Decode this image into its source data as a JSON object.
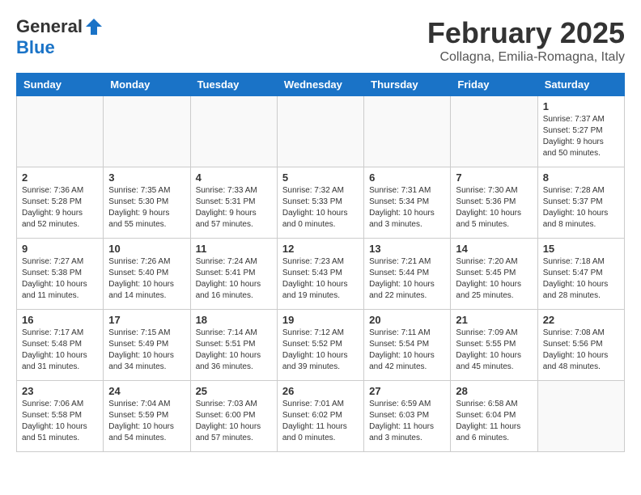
{
  "header": {
    "logo": {
      "general": "General",
      "blue": "Blue"
    },
    "title": "February 2025",
    "subtitle": "Collagna, Emilia-Romagna, Italy"
  },
  "weekdays": [
    "Sunday",
    "Monday",
    "Tuesday",
    "Wednesday",
    "Thursday",
    "Friday",
    "Saturday"
  ],
  "weeks": [
    {
      "days": [
        {
          "num": "",
          "info": ""
        },
        {
          "num": "",
          "info": ""
        },
        {
          "num": "",
          "info": ""
        },
        {
          "num": "",
          "info": ""
        },
        {
          "num": "",
          "info": ""
        },
        {
          "num": "",
          "info": ""
        },
        {
          "num": "1",
          "info": "Sunrise: 7:37 AM\nSunset: 5:27 PM\nDaylight: 9 hours\nand 50 minutes."
        }
      ]
    },
    {
      "days": [
        {
          "num": "2",
          "info": "Sunrise: 7:36 AM\nSunset: 5:28 PM\nDaylight: 9 hours\nand 52 minutes."
        },
        {
          "num": "3",
          "info": "Sunrise: 7:35 AM\nSunset: 5:30 PM\nDaylight: 9 hours\nand 55 minutes."
        },
        {
          "num": "4",
          "info": "Sunrise: 7:33 AM\nSunset: 5:31 PM\nDaylight: 9 hours\nand 57 minutes."
        },
        {
          "num": "5",
          "info": "Sunrise: 7:32 AM\nSunset: 5:33 PM\nDaylight: 10 hours\nand 0 minutes."
        },
        {
          "num": "6",
          "info": "Sunrise: 7:31 AM\nSunset: 5:34 PM\nDaylight: 10 hours\nand 3 minutes."
        },
        {
          "num": "7",
          "info": "Sunrise: 7:30 AM\nSunset: 5:36 PM\nDaylight: 10 hours\nand 5 minutes."
        },
        {
          "num": "8",
          "info": "Sunrise: 7:28 AM\nSunset: 5:37 PM\nDaylight: 10 hours\nand 8 minutes."
        }
      ]
    },
    {
      "days": [
        {
          "num": "9",
          "info": "Sunrise: 7:27 AM\nSunset: 5:38 PM\nDaylight: 10 hours\nand 11 minutes."
        },
        {
          "num": "10",
          "info": "Sunrise: 7:26 AM\nSunset: 5:40 PM\nDaylight: 10 hours\nand 14 minutes."
        },
        {
          "num": "11",
          "info": "Sunrise: 7:24 AM\nSunset: 5:41 PM\nDaylight: 10 hours\nand 16 minutes."
        },
        {
          "num": "12",
          "info": "Sunrise: 7:23 AM\nSunset: 5:43 PM\nDaylight: 10 hours\nand 19 minutes."
        },
        {
          "num": "13",
          "info": "Sunrise: 7:21 AM\nSunset: 5:44 PM\nDaylight: 10 hours\nand 22 minutes."
        },
        {
          "num": "14",
          "info": "Sunrise: 7:20 AM\nSunset: 5:45 PM\nDaylight: 10 hours\nand 25 minutes."
        },
        {
          "num": "15",
          "info": "Sunrise: 7:18 AM\nSunset: 5:47 PM\nDaylight: 10 hours\nand 28 minutes."
        }
      ]
    },
    {
      "days": [
        {
          "num": "16",
          "info": "Sunrise: 7:17 AM\nSunset: 5:48 PM\nDaylight: 10 hours\nand 31 minutes."
        },
        {
          "num": "17",
          "info": "Sunrise: 7:15 AM\nSunset: 5:49 PM\nDaylight: 10 hours\nand 34 minutes."
        },
        {
          "num": "18",
          "info": "Sunrise: 7:14 AM\nSunset: 5:51 PM\nDaylight: 10 hours\nand 36 minutes."
        },
        {
          "num": "19",
          "info": "Sunrise: 7:12 AM\nSunset: 5:52 PM\nDaylight: 10 hours\nand 39 minutes."
        },
        {
          "num": "20",
          "info": "Sunrise: 7:11 AM\nSunset: 5:54 PM\nDaylight: 10 hours\nand 42 minutes."
        },
        {
          "num": "21",
          "info": "Sunrise: 7:09 AM\nSunset: 5:55 PM\nDaylight: 10 hours\nand 45 minutes."
        },
        {
          "num": "22",
          "info": "Sunrise: 7:08 AM\nSunset: 5:56 PM\nDaylight: 10 hours\nand 48 minutes."
        }
      ]
    },
    {
      "days": [
        {
          "num": "23",
          "info": "Sunrise: 7:06 AM\nSunset: 5:58 PM\nDaylight: 10 hours\nand 51 minutes."
        },
        {
          "num": "24",
          "info": "Sunrise: 7:04 AM\nSunset: 5:59 PM\nDaylight: 10 hours\nand 54 minutes."
        },
        {
          "num": "25",
          "info": "Sunrise: 7:03 AM\nSunset: 6:00 PM\nDaylight: 10 hours\nand 57 minutes."
        },
        {
          "num": "26",
          "info": "Sunrise: 7:01 AM\nSunset: 6:02 PM\nDaylight: 11 hours\nand 0 minutes."
        },
        {
          "num": "27",
          "info": "Sunrise: 6:59 AM\nSunset: 6:03 PM\nDaylight: 11 hours\nand 3 minutes."
        },
        {
          "num": "28",
          "info": "Sunrise: 6:58 AM\nSunset: 6:04 PM\nDaylight: 11 hours\nand 6 minutes."
        },
        {
          "num": "",
          "info": ""
        }
      ]
    }
  ]
}
